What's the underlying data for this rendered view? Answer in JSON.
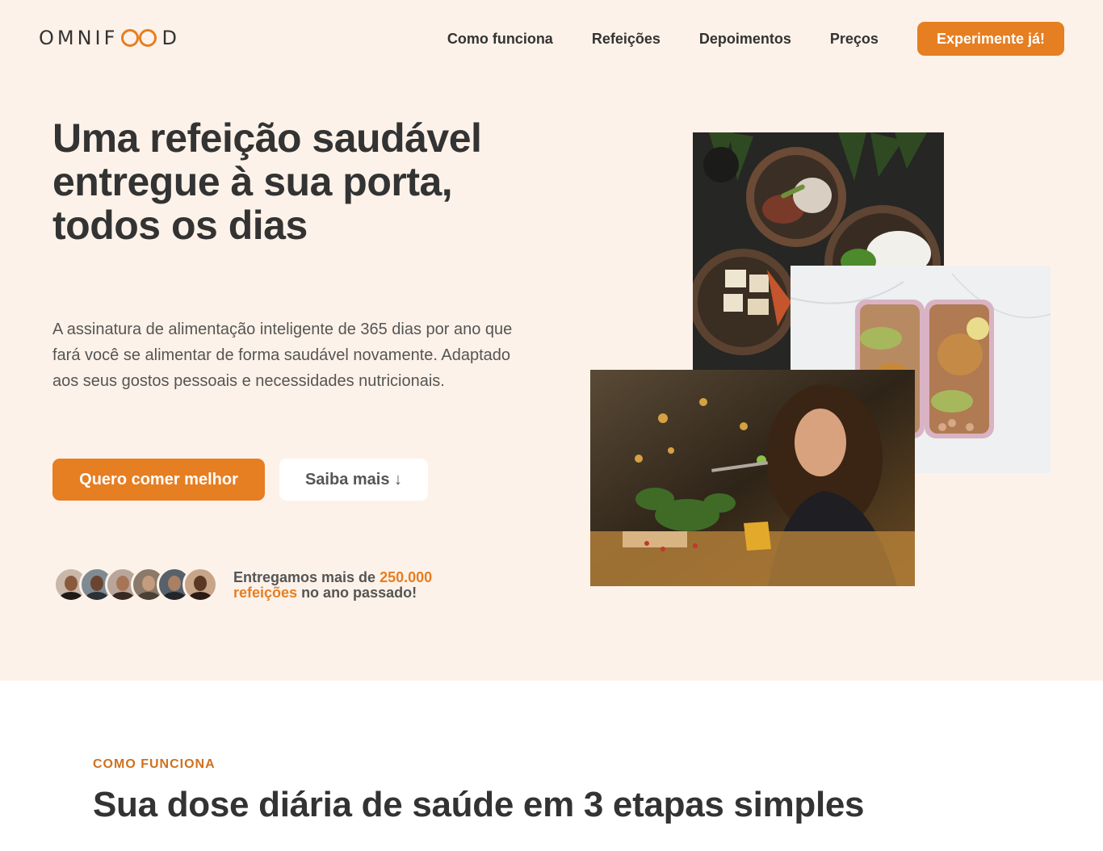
{
  "header": {
    "logo_left": "OMNIF",
    "logo_right": "D",
    "nav": [
      "Como funciona",
      "Refeições",
      "Depoimentos",
      "Preços"
    ],
    "cta": "Experimente já!"
  },
  "hero": {
    "title": "Uma refeição saudável entregue à sua porta, todos os dias",
    "description": "A assinatura de alimentação inteligente de 365 dias por ano que fará você se alimentar de forma saudável novamente. Adaptado aos seus gostos pessoais e necessidades nutricionais.",
    "primary_button": "Quero comer melhor",
    "secondary_button": "Saiba mais ↓",
    "delivered": {
      "prefix": "Entregamos mais de ",
      "highlight": "250.000 refeições",
      "suffix": " no ano passado!"
    }
  },
  "how": {
    "subheading": "COMO FUNCIONA",
    "title": "Sua dose diária de saúde em 3 etapas simples"
  },
  "colors": {
    "accent": "#e67e22",
    "hero_background": "#fdf2e9",
    "text": "#333333"
  }
}
